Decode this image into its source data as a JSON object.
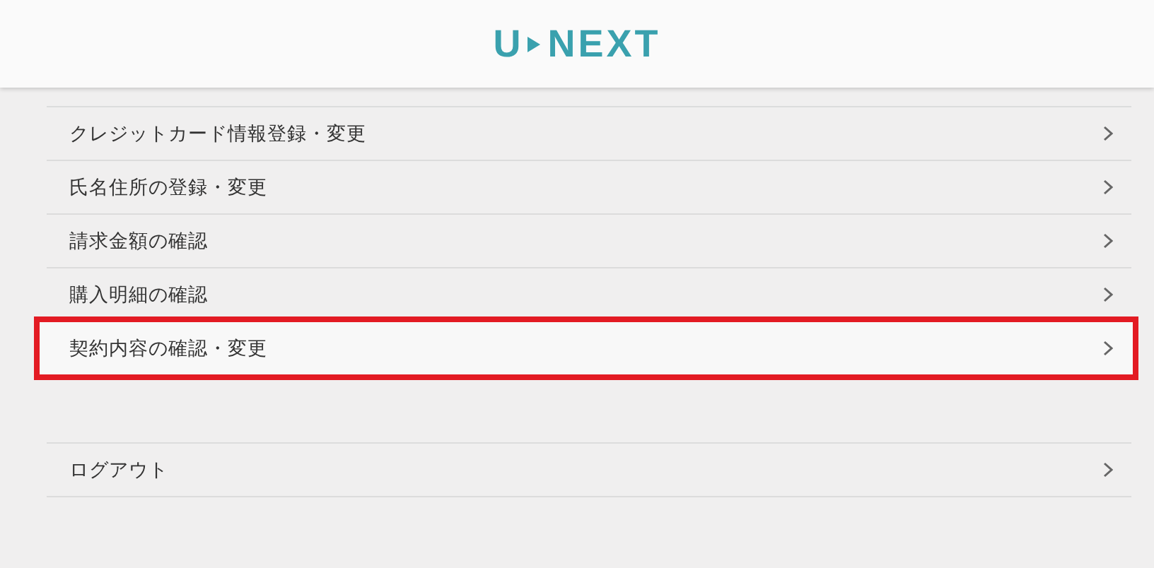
{
  "header": {
    "logo": {
      "left": "U",
      "right": "NEXT"
    }
  },
  "menu": [
    {
      "label": "クレジットカード情報登録・変更",
      "highlighted": false
    },
    {
      "label": "氏名住所の登録・変更",
      "highlighted": false
    },
    {
      "label": "請求金額の確認",
      "highlighted": false
    },
    {
      "label": "購入明細の確認",
      "highlighted": false
    },
    {
      "label": "契約内容の確認・変更",
      "highlighted": true
    }
  ],
  "footer_menu": [
    {
      "label": "ログアウト",
      "highlighted": false
    }
  ]
}
